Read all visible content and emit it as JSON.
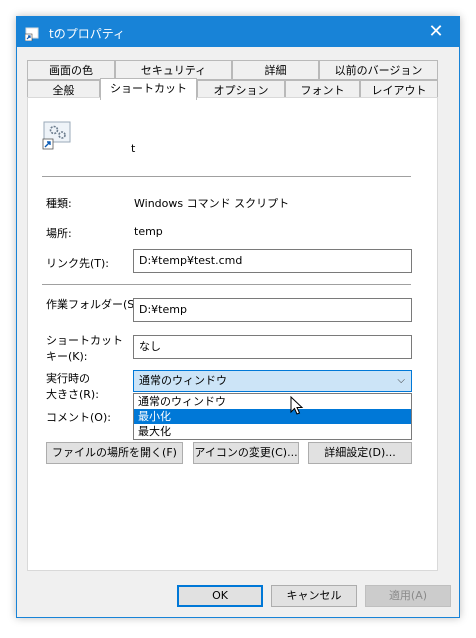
{
  "window": {
    "title": "tのプロパティ",
    "close_glyph": "✕"
  },
  "tabs_top": [
    "画面の色",
    "セキュリティ",
    "詳細",
    "以前のバージョン"
  ],
  "tabs_bottom": [
    "全般",
    "ショートカット",
    "オプション",
    "フォント",
    "レイアウト"
  ],
  "active_tab": "ショートカット",
  "shortcut": {
    "name": "t",
    "type_label": "種類:",
    "type_value": "Windows コマンド スクリプト",
    "location_label": "場所:",
    "location_value": "temp",
    "target_label": "リンク先(T):",
    "target_value": "D:¥temp¥test.cmd",
    "startin_label": "作業フォルダー(S):",
    "startin_value": "D:¥temp",
    "hotkey_label_1": "ショートカット",
    "hotkey_label_2": "キー(K):",
    "hotkey_value": "なし",
    "run_label_1": "実行時の",
    "run_label_2": "大きさ(R):",
    "run_selected": "通常のウィンドウ",
    "run_options": [
      "通常のウィンドウ",
      "最小化",
      "最大化"
    ],
    "highlighted_option": "最小化",
    "comment_label": "コメント(O):",
    "open_location_button": "ファイルの場所を開く(F)",
    "change_icon_button": "アイコンの変更(C)...",
    "advanced_button": "詳細設定(D)..."
  },
  "footer": {
    "ok": "OK",
    "cancel": "キャンセル",
    "apply": "適用(A)"
  },
  "colors": {
    "accent": "#0078d7",
    "titlebar": "#1883d7",
    "select_bg": "#cce4f7"
  }
}
